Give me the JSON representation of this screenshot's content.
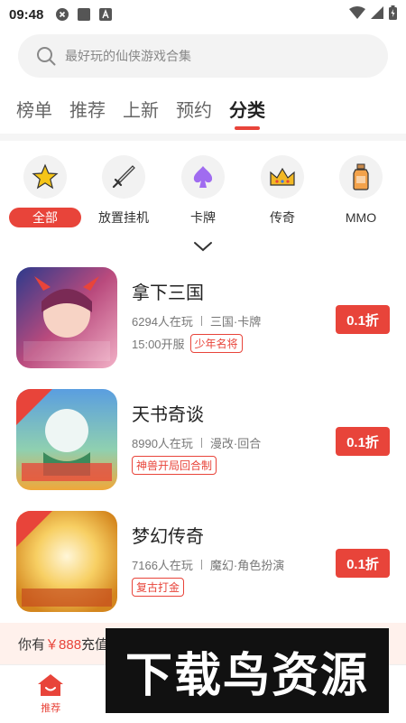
{
  "status_bar": {
    "time": "09:48"
  },
  "search": {
    "placeholder": "最好玩的仙侠游戏合集"
  },
  "tabs": [
    {
      "label": "榜单",
      "active": false
    },
    {
      "label": "推荐",
      "active": false
    },
    {
      "label": "上新",
      "active": false
    },
    {
      "label": "预约",
      "active": false
    },
    {
      "label": "分类",
      "active": true
    }
  ],
  "categories": [
    {
      "label": "全部",
      "icon": "star-icon",
      "active": true
    },
    {
      "label": "放置挂机",
      "icon": "sword-icon",
      "active": false
    },
    {
      "label": "卡牌",
      "icon": "spade-card-icon",
      "active": false
    },
    {
      "label": "传奇",
      "icon": "crown-icon",
      "active": false
    },
    {
      "label": "MMO",
      "icon": "potion-icon",
      "active": false
    }
  ],
  "games": [
    {
      "name": "拿下三国",
      "players": "6294人在玩",
      "genre": "三国·卡牌",
      "open_time": "15:00开服",
      "tag": "少年名将",
      "discount": "0.1折"
    },
    {
      "name": "天书奇谈",
      "players": "8990人在玩",
      "genre": "漫改·回合",
      "open_time": "",
      "tag": "神兽开局回合制",
      "discount": "0.1折"
    },
    {
      "name": "梦幻传奇",
      "players": "7166人在玩",
      "genre": "魔幻·角色扮演",
      "open_time": "",
      "tag": "复古打金",
      "discount": "0.1折"
    }
  ],
  "banner": {
    "prefix": "你有",
    "amount": "￥888",
    "suffix": "充值"
  },
  "bottom_nav": [
    {
      "label": "推荐",
      "icon": "home-icon",
      "active": true
    },
    {
      "label": "",
      "icon": "game-icon",
      "active": false
    },
    {
      "label": "",
      "icon": "discover-icon",
      "active": false
    },
    {
      "label": "",
      "icon": "profile-icon",
      "active": false
    }
  ],
  "watermark": {
    "text": "下载鸟资源"
  },
  "colors": {
    "accent": "#e8443a",
    "banner_bg": "#fff1ec"
  }
}
